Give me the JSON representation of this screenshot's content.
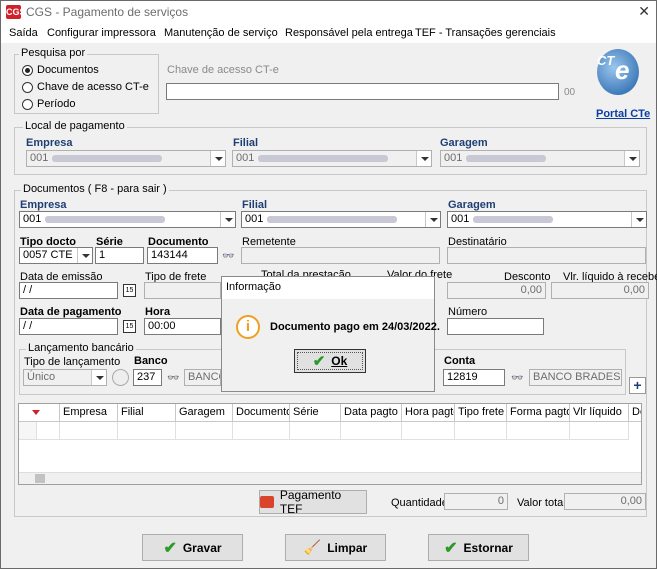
{
  "window": {
    "title": "CGS - Pagamento de serviços",
    "logo": "CGS",
    "close": "✕"
  },
  "menu": [
    "Saída",
    "Configurar impressora",
    "Manutenção de serviço",
    "Responsável pela entrega",
    "TEF - Transações gerenciais"
  ],
  "pesquisa": {
    "legend": "Pesquisa por",
    "options": [
      "Documentos",
      "Chave de acesso CT-e",
      "Período"
    ],
    "chave_label": "Chave de acesso CT-e",
    "chave_suffix": "00"
  },
  "cte": {
    "logo": "CT",
    "link": "Portal CTe"
  },
  "local": {
    "legend": "Local de pagamento",
    "empresa_label": "Empresa",
    "filial_label": "Filial",
    "garagem_label": "Garagem",
    "empresa": "001",
    "filial": "001",
    "garagem": "001"
  },
  "documentos": {
    "legend": "Documentos ( F8 - para sair )",
    "empresa_label": "Empresa",
    "filial_label": "Filial",
    "garagem_label": "Garagem",
    "empresa": "001",
    "filial": "001",
    "garagem": "001",
    "tipo_label": "Tipo docto",
    "tipo": "0057 CTE",
    "serie_label": "Série",
    "serie": "1",
    "documento_label": "Documento",
    "documento": "143144",
    "remetente_label": "Remetente",
    "destinatario_label": "Destinatário",
    "emissao_label": "Data de emissão",
    "emissao": " /  /",
    "frete_label": "Tipo de frete",
    "total_label": "Total da prestação",
    "valor_frete_label": "Valor do frete",
    "desconto_label": "Desconto",
    "desconto": "0,00",
    "liquido_label": "Vlr. líquido à receber",
    "liquido": "0,00",
    "pagamento_label": "Data de pagamento",
    "pagamento": " /  /",
    "hora_label": "Hora",
    "hora": "00:00",
    "numero_label": "Número"
  },
  "lancamento": {
    "legend": "Lançamento bancário",
    "tipo_label": "Tipo de lançamento",
    "tipo": "Único",
    "banco_label": "Banco",
    "banco": "237",
    "banco_nome": "BANCO",
    "conta_label": "Conta",
    "conta": "12819",
    "conta_banco": "BANCO BRADESCO"
  },
  "grid": {
    "headers": [
      "Empresa",
      "Filial",
      "Garagem",
      "Documento",
      "Série",
      "Data pagto",
      "Hora pagto",
      "Tipo frete",
      "Forma pagto",
      "Vlr líquido",
      "Des"
    ]
  },
  "footer": {
    "tef": "Pagamento TEF",
    "quantidade_label": "Quantidade",
    "quantidade": "0",
    "valor_total_label": "Valor total",
    "valor_total": "0,00"
  },
  "actions": {
    "gravar": "Gravar",
    "limpar": "Limpar",
    "estornar": "Estornar"
  },
  "dialog": {
    "title": "Informação",
    "message": "Documento pago em 24/03/2022.",
    "ok": "Ok",
    "icon": "info-icon"
  }
}
